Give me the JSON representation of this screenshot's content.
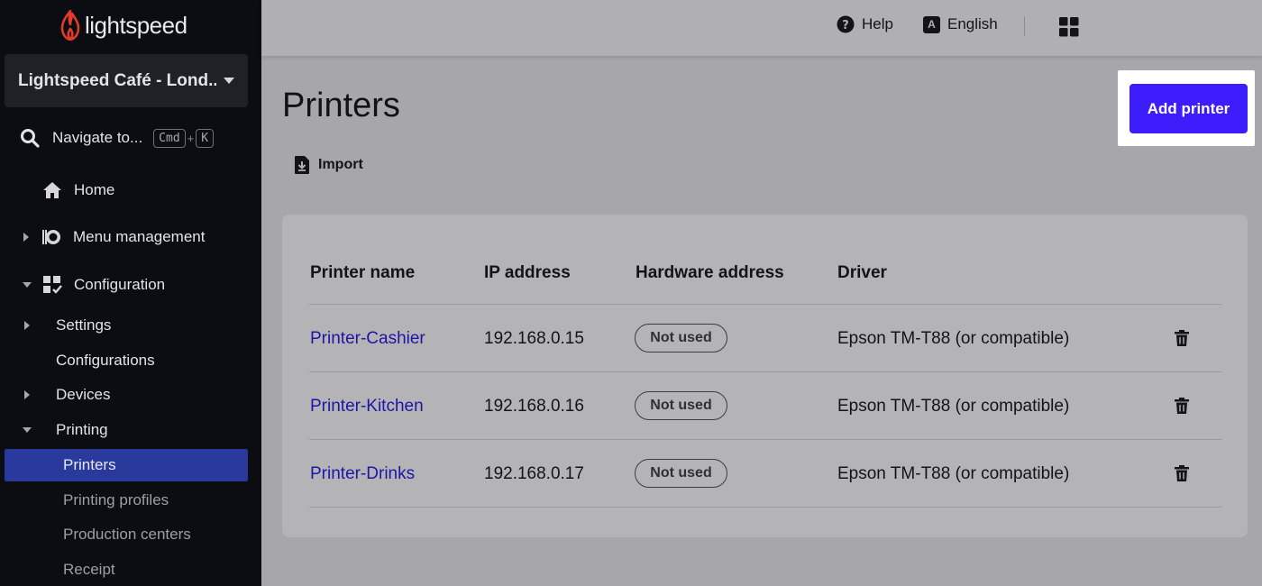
{
  "brand": {
    "name": "lightspeed"
  },
  "sidebar": {
    "store_selector": "Lightspeed Café - Lond...",
    "navigate": {
      "label": "Navigate to...",
      "key1": "Cmd",
      "plus": "+",
      "key2": "K"
    },
    "home": "Home",
    "menu_management": "Menu management",
    "configuration": "Configuration",
    "settings": "Settings",
    "configurations": "Configurations",
    "devices": "Devices",
    "printing": "Printing",
    "printers": "Printers",
    "printing_profiles": "Printing profiles",
    "production_centers": "Production centers",
    "receipt": "Receipt"
  },
  "topbar": {
    "help": "Help",
    "language": "English",
    "language_icon_letter": "A"
  },
  "page": {
    "title": "Printers",
    "import_label": "Import",
    "add_button": "Add printer"
  },
  "table": {
    "headers": {
      "name": "Printer name",
      "ip": "IP address",
      "hardware": "Hardware address",
      "driver": "Driver"
    },
    "rows": [
      {
        "name": "Printer-Cashier",
        "ip": "192.168.0.15",
        "hardware": "Not used",
        "driver": "Epson TM-T88 (or compatible)"
      },
      {
        "name": "Printer-Kitchen",
        "ip": "192.168.0.16",
        "hardware": "Not used",
        "driver": "Epson TM-T88 (or compatible)"
      },
      {
        "name": "Printer-Drinks",
        "ip": "192.168.0.17",
        "hardware": "Not used",
        "driver": "Epson TM-T88 (or compatible)"
      }
    ]
  },
  "colors": {
    "accent": "#3d1dfb",
    "sidebar_bg": "#0b0d12",
    "active_item": "#2a3a9c",
    "link": "#1e14a7",
    "logo": "#e33b2b"
  }
}
